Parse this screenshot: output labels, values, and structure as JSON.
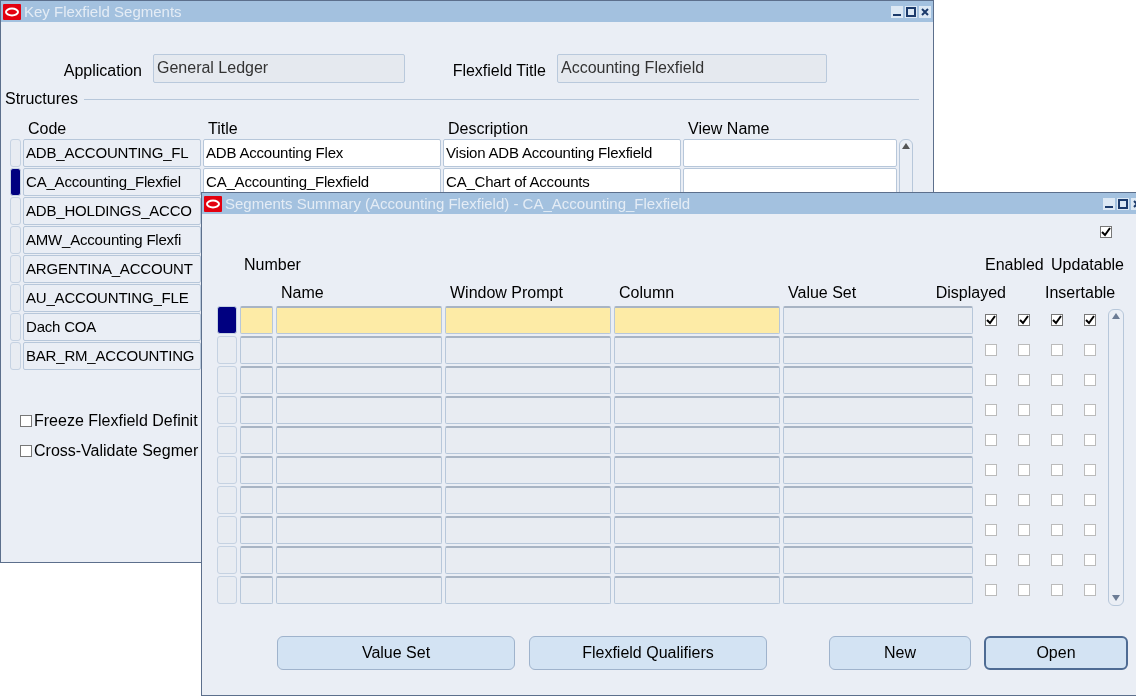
{
  "main_window": {
    "title": "Key Flexfield Segments",
    "application": {
      "label": "Application",
      "value": "General Ledger"
    },
    "flexfield_title": {
      "label": "Flexfield Title",
      "value": "Accounting Flexfield"
    },
    "structures": {
      "label": "Structures",
      "columns": [
        "Code",
        "Title",
        "Description",
        "View Name"
      ],
      "rows": [
        {
          "selected": false,
          "code": "ADB_ACCOUNTING_FL",
          "title": "ADB Accounting Flex",
          "description": "Vision ADB Accounting Flexfield"
        },
        {
          "selected": true,
          "code": "CA_Accounting_Flexfiel",
          "title": "CA_Accounting_Flexfield",
          "description": "CA_Chart of Accounts"
        },
        {
          "selected": false,
          "code": "ADB_HOLDINGS_ACCO"
        },
        {
          "selected": false,
          "code": "AMW_Accounting Flexfi"
        },
        {
          "selected": false,
          "code": "ARGENTINA_ACCOUNT"
        },
        {
          "selected": false,
          "code": "AU_ACCOUNTING_FLE"
        },
        {
          "selected": false,
          "code": "Dach COA"
        },
        {
          "selected": false,
          "code": "BAR_RM_ACCOUNTING"
        }
      ]
    },
    "options": [
      {
        "label": "Freeze Flexfield Definit",
        "checked": false
      },
      {
        "label": "Cross-Validate Segmer",
        "checked": false
      }
    ]
  },
  "segments_window": {
    "title": "Segments Summary (Accounting Flexfield) - CA_Accounting_Flexfield",
    "top_checkbox": {
      "checked": true
    },
    "columns": {
      "number": "Number",
      "name": "Name",
      "window_prompt": "Window Prompt",
      "column": "Column",
      "value_set": "Value Set",
      "displayed": "Displayed",
      "enabled": "Enabled",
      "updatable": "Updatable",
      "insertable": "Insertable"
    },
    "rows": [
      {
        "selected": true,
        "displayed": true,
        "enabled": true,
        "insertable": true,
        "updatable": true
      },
      {
        "selected": false,
        "displayed": false,
        "enabled": false,
        "insertable": false,
        "updatable": false
      },
      {
        "selected": false,
        "displayed": false,
        "enabled": false,
        "insertable": false,
        "updatable": false
      },
      {
        "selected": false,
        "displayed": false,
        "enabled": false,
        "insertable": false,
        "updatable": false
      },
      {
        "selected": false,
        "displayed": false,
        "enabled": false,
        "insertable": false,
        "updatable": false
      },
      {
        "selected": false,
        "displayed": false,
        "enabled": false,
        "insertable": false,
        "updatable": false
      },
      {
        "selected": false,
        "displayed": false,
        "enabled": false,
        "insertable": false,
        "updatable": false
      },
      {
        "selected": false,
        "displayed": false,
        "enabled": false,
        "insertable": false,
        "updatable": false
      },
      {
        "selected": false,
        "displayed": false,
        "enabled": false,
        "insertable": false,
        "updatable": false
      },
      {
        "selected": false,
        "displayed": false,
        "enabled": false,
        "insertable": false,
        "updatable": false
      }
    ],
    "buttons": [
      {
        "label": "Value Set",
        "default": false
      },
      {
        "label": "Flexfield Qualifiers",
        "default": false
      },
      {
        "label": "New",
        "default": false
      },
      {
        "label": "Open",
        "default": true
      }
    ]
  }
}
